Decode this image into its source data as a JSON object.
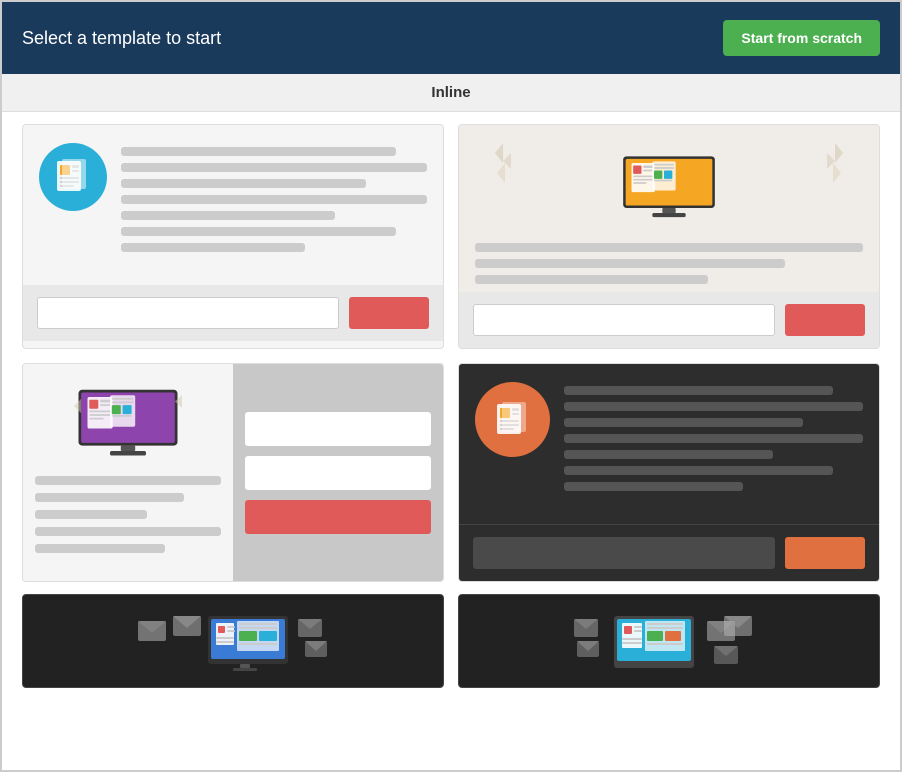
{
  "header": {
    "title": "Select a template to start",
    "scratch_button": "Start from scratch"
  },
  "section": {
    "label": "Inline"
  },
  "templates": [
    {
      "id": "template-1",
      "style": "light-icon-left",
      "footer_input_placeholder": "",
      "footer_button_label": ""
    },
    {
      "id": "template-2",
      "style": "light-monitor-top",
      "footer_input_placeholder": "",
      "footer_button_label": ""
    },
    {
      "id": "template-3",
      "style": "light-two-column",
      "footer_input_placeholder": "",
      "footer_button_label": ""
    },
    {
      "id": "template-4",
      "style": "dark-icon-left",
      "footer_input_placeholder": "",
      "footer_button_label": ""
    }
  ],
  "bottom_templates": [
    {
      "id": "template-5",
      "style": "dark-envelopes-left"
    },
    {
      "id": "template-6",
      "style": "dark-envelopes-right"
    }
  ],
  "colors": {
    "header_bg": "#1a3a5c",
    "accent_green": "#4caf50",
    "accent_red": "#e05a5a",
    "accent_orange": "#e07040",
    "icon_blue": "#2ab0d8",
    "icon_orange": "#e07040",
    "dark_bg": "#2d2d2d",
    "very_dark_bg": "#222222"
  }
}
